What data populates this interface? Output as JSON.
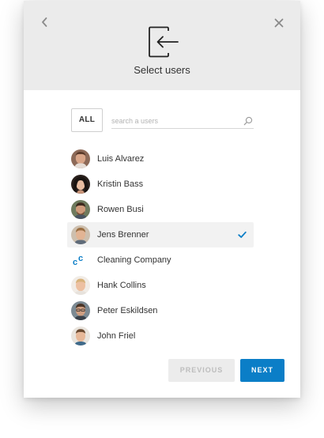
{
  "header": {
    "title": "Select users",
    "back_icon": "chevron-left-icon",
    "close_icon": "close-icon",
    "main_icon": "sign-in-arrow-icon"
  },
  "filter": {
    "all_label": "ALL",
    "search_placeholder": "search a users",
    "search_value": ""
  },
  "users": [
    {
      "name": "Luis Alvarez",
      "avatar": "photo",
      "selected": false
    },
    {
      "name": "Kristin Bass",
      "avatar": "photo",
      "selected": false
    },
    {
      "name": "Rowen Busi",
      "avatar": "photo",
      "selected": false
    },
    {
      "name": "Jens Brenner",
      "avatar": "photo",
      "selected": true
    },
    {
      "name": "Cleaning Company",
      "avatar": "cc-logo",
      "selected": false
    },
    {
      "name": "Hank Collins",
      "avatar": "photo",
      "selected": false
    },
    {
      "name": "Peter Eskildsen",
      "avatar": "photo",
      "selected": false
    },
    {
      "name": "John Friel",
      "avatar": "photo",
      "selected": false
    }
  ],
  "footer": {
    "previous_label": "PREVIOUS",
    "next_label": "NEXT"
  },
  "colors": {
    "accent": "#0b7ec7",
    "header_bg": "#ebebeb",
    "selected_row_bg": "#f2f2f2"
  }
}
